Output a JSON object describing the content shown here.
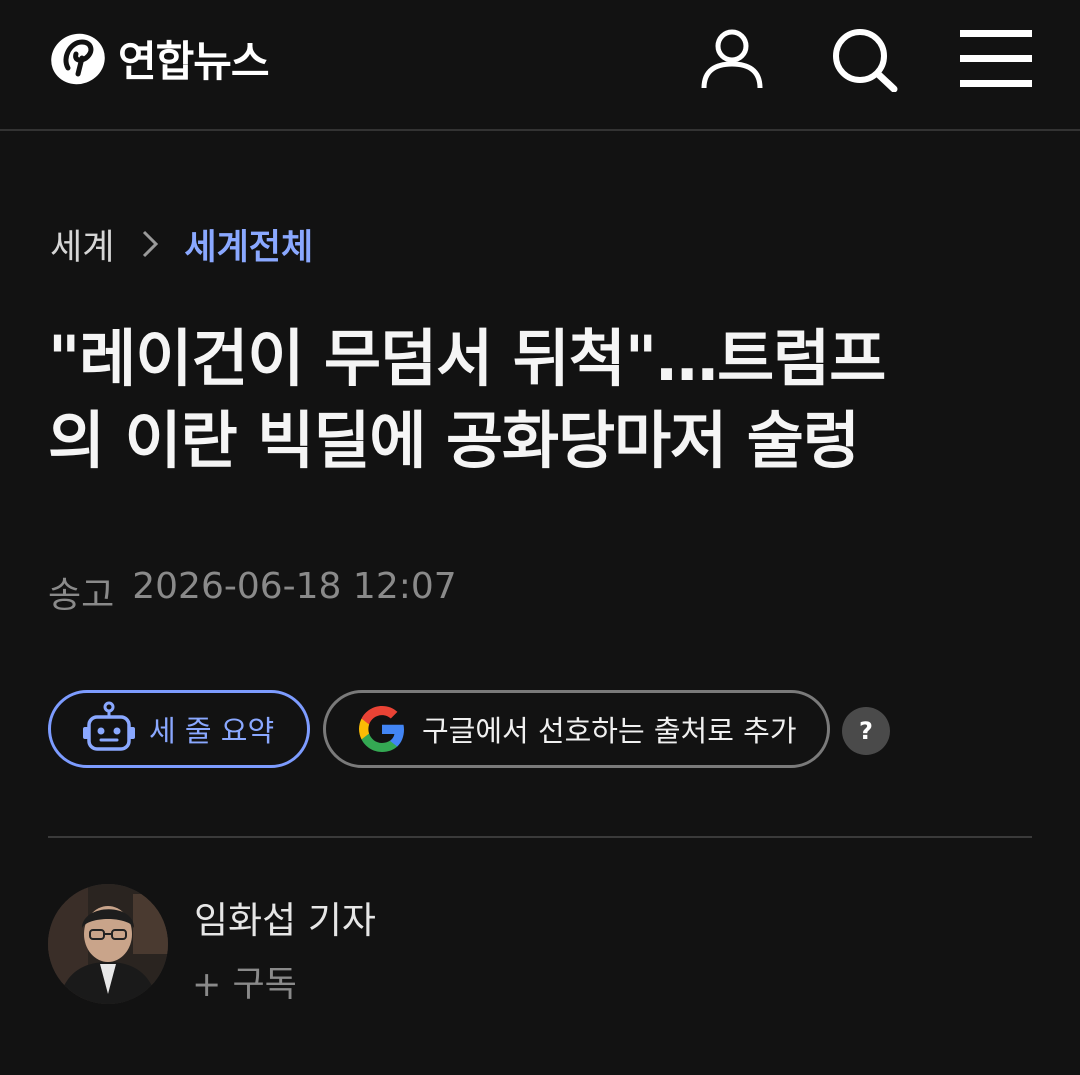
{
  "header": {
    "logo_text": "연합뉴스",
    "icons": [
      "logo-icon",
      "user-icon",
      "search-icon",
      "menu-icon"
    ]
  },
  "breadcrumb": {
    "section": "세계",
    "subsection": "세계전체"
  },
  "article": {
    "headline_line1": "\"레이건이 무덤서 뒤척\"…트럼프",
    "headline_line2": "의 이란 빅딜에 공화당마저 술렁",
    "type": "송고",
    "datetime": "2026-06-18 12:07"
  },
  "actions": {
    "summary_label": "세 줄 요약",
    "google_label": "구글에서 선호하는 출처로 추가",
    "help_label": "?"
  },
  "reporter": {
    "name": "임화섭 기자",
    "subscribe_label": "+ 구독"
  },
  "colors": {
    "background": "#121212",
    "accent": "#8aa8ff",
    "muted": "#8a8a8a"
  }
}
